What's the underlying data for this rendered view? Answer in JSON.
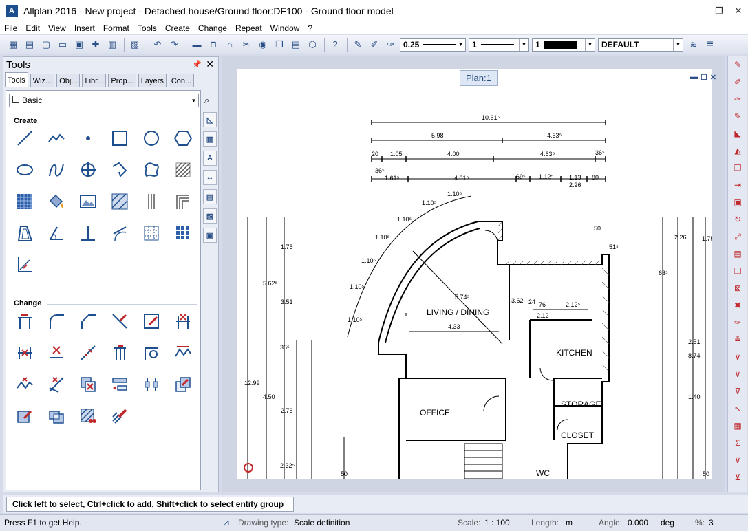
{
  "window": {
    "title": "Allplan 2016 - New project - Detached house/Ground floor:DF100 - Ground floor model",
    "minimize": "–",
    "restore": "❐",
    "close": "✕"
  },
  "menu": [
    "File",
    "Edit",
    "View",
    "Insert",
    "Format",
    "Tools",
    "Create",
    "Change",
    "Repeat",
    "Window",
    "?"
  ],
  "toolbar": {
    "pen_thickness": "0.25",
    "line_type": "1",
    "color_number": "1",
    "layer": "DEFAULT"
  },
  "tools_panel": {
    "title": "Tools",
    "pin": "📌",
    "close": "✕",
    "tabs": [
      "Tools",
      "Wiz...",
      "Obj...",
      "Libr...",
      "Prop...",
      "Layers",
      "Con..."
    ],
    "category": "Basic",
    "create_label": "Create",
    "change_label": "Change"
  },
  "drawing": {
    "plan_tab": "Plan:1",
    "rooms": [
      "LIVING / DINING",
      "KITCHEN",
      "OFFICE",
      "STORAGE",
      "CLOSET",
      "WC"
    ],
    "dims_top": [
      "10.61⁵",
      "5.98",
      "4.63⁵",
      "20",
      "1.05",
      "4.00",
      "4.63⁵",
      "36⁵",
      "36⁵",
      "1.61⁵",
      "4.01⁵",
      "69⁵",
      "1.12⁵",
      "1.13",
      "2.26",
      "80"
    ],
    "dims_arc": [
      "1.10⁵",
      "1.10⁵",
      "1.10⁵",
      "1.10⁵",
      "1.10⁵",
      "1.10⁵",
      "1.10⁵"
    ],
    "dims_inner": [
      "5.74⁵",
      "4.33",
      "3.62",
      "2.12⁵",
      "24",
      "76",
      "2.12",
      "50",
      "51⁵"
    ],
    "dims_left": [
      "12.99",
      "5.62⁵",
      "4.50",
      "1.75",
      "3.51",
      "2.76",
      "36⁵",
      "2.32⁵",
      "50"
    ],
    "dims_right": [
      "8.74",
      "1.75",
      "2.26",
      "63⁵",
      "2.51",
      "1.40",
      "50"
    ]
  },
  "prompt": "Click left to select, Ctrl+click to add, Shift+click to select entity group",
  "status": {
    "help": "Press F1 to get Help.",
    "drawing_type_label": "Drawing type:",
    "drawing_type": "Scale definition",
    "scale_label": "Scale:",
    "scale": "1 : 100",
    "length_label": "Length:",
    "length": "m",
    "angle_label": "Angle:",
    "angle": "0.000",
    "angle_unit": "deg",
    "percent_label": "%:",
    "percent": "3"
  }
}
